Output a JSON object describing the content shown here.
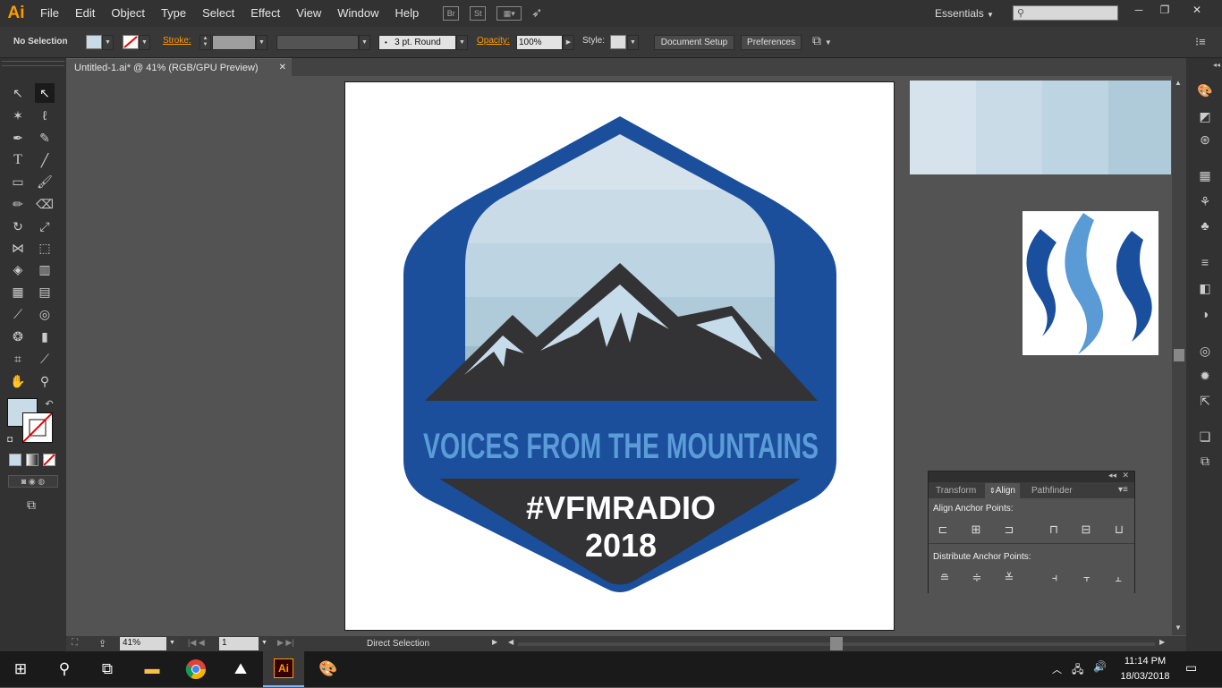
{
  "app": {
    "logo": "Ai"
  },
  "menu": [
    "File",
    "Edit",
    "Object",
    "Type",
    "Select",
    "Effect",
    "View",
    "Window",
    "Help"
  ],
  "menubar_icons": {
    "br": "Br",
    "st": "St"
  },
  "workspace": {
    "label": "Essentials",
    "arrow": "▼"
  },
  "window_controls": {
    "minimize": "─",
    "restore": "❐",
    "close": "✕"
  },
  "control_bar": {
    "selection": "No Selection",
    "stroke_label": "Stroke:",
    "brush": "3 pt. Round",
    "opacity_label": "Opacity:",
    "opacity_value": "100%",
    "style_label": "Style:",
    "document_setup": "Document Setup",
    "preferences": "Preferences"
  },
  "document_tab": {
    "title": "Untitled-1.ai* @ 41% (RGB/GPU Preview)",
    "close": "✕"
  },
  "artwork": {
    "tagline": "VOICES FROM THE MOUNTAINS",
    "hashtag": "#VFMRADIO",
    "year": "2018"
  },
  "align_panel": {
    "tabs": [
      "Transform",
      "Align",
      "Pathfinder"
    ],
    "active_tab": "Align",
    "section1": "Align Anchor Points:",
    "section2": "Distribute Anchor Points:"
  },
  "status_bar": {
    "zoom": "41%",
    "page": "1",
    "tool": "Direct Selection"
  },
  "taskbar": {
    "time": "11:14 PM",
    "date": "18/03/2018"
  },
  "colors": {
    "accent_orange": "#ff9a00",
    "badge_blue": "#1b4f9c",
    "text_blue": "#5b9bd8",
    "mountain_dark": "#333234",
    "sky_band_1": "#d6e3ec",
    "sky_band_2": "#c9dbe7",
    "sky_band_3": "#bdd4e2",
    "sky_band_4": "#afcad9",
    "sky_band_5": "#9fbcca"
  }
}
